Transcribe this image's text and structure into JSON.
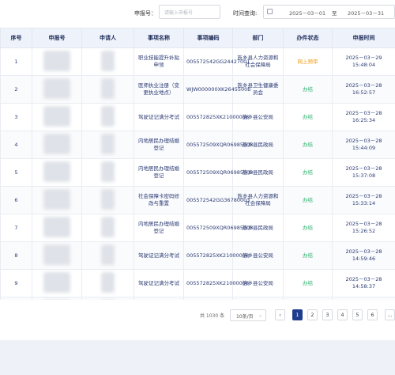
{
  "filters": {
    "application_no_label": "申报号：",
    "application_no_placeholder": "请输入申报号",
    "time_query_label": "时间查询:",
    "date_start": "2025－03－01",
    "date_to": "至",
    "date_end": "2025－03－31"
  },
  "table": {
    "columns": [
      "序号",
      "申报号",
      "申请人",
      "事项名称",
      "事项编码",
      "部门",
      "办件状态",
      "申报时间"
    ],
    "rows": [
      {
        "no": "1",
        "item": "职业技能提升补贴申领",
        "code": "005572542GG24427001",
        "dept": "旌乡县人力资源和社会保障局",
        "status": "网上预审",
        "status_type": "back",
        "time": "2025－03－29 15:48:04"
      },
      {
        "no": "2",
        "item": "医师执业注册（变更执业地点）",
        "code": "WJW000000XK2645500b",
        "dept": "旌乡县卫生健康委员会",
        "status": "办结",
        "status_type": "ok",
        "time": "2025－03－28 16:52:57"
      },
      {
        "no": "3",
        "item": "驾驶证记满分考试",
        "code": "005572825XK21000008",
        "dept": "旌乡县公安局",
        "status": "办结",
        "status_type": "ok",
        "time": "2025－03－28 16:25:34"
      },
      {
        "no": "4",
        "item": "内地居民办理结婚登记",
        "code": "005572509XQR06985003",
        "dept": "旌乡县民政局",
        "status": "办结",
        "status_type": "ok",
        "time": "2025－03－28 15:44:09"
      },
      {
        "no": "5",
        "item": "内地居民办理结婚登记",
        "code": "005572509XQR06985003",
        "dept": "旌乡县民政局",
        "status": "办结",
        "status_type": "ok",
        "time": "2025－03－28 15:37:08"
      },
      {
        "no": "6",
        "item": "社会保障卡密码修改与重置",
        "code": "005572542GG36780003",
        "dept": "旌乡县人力资源和社会保障局",
        "status": "办结",
        "status_type": "ok",
        "time": "2025－03－28 15:33:14"
      },
      {
        "no": "7",
        "item": "内地居民办理结婚登记",
        "code": "005572509XQR06985003",
        "dept": "旌乡县民政局",
        "status": "办结",
        "status_type": "ok",
        "time": "2025－03－28 15:26:52"
      },
      {
        "no": "8",
        "item": "驾驶证记满分考试",
        "code": "005572825XK21000008",
        "dept": "旌乡县公安局",
        "status": "办结",
        "status_type": "ok",
        "time": "2025－03－28 14:59:46"
      },
      {
        "no": "9",
        "item": "驾驶证记满分考试",
        "code": "005572825XK21000008",
        "dept": "旌乡县公安局",
        "status": "办结",
        "status_type": "ok",
        "time": "2025－03－28 14:58:37"
      },
      {
        "no": "10",
        "item": "驾驶证记满分考试",
        "code": "005572825XK21000008",
        "dept": "旌乡县公安局",
        "status": "办结",
        "status_type": "ok",
        "time": "2025－03－28 14:55:23"
      }
    ]
  },
  "pagination": {
    "total": "共 1030 条",
    "page_size": "10条/页",
    "prev": "‹",
    "pages": [
      "1",
      "2",
      "3",
      "4",
      "5",
      "6"
    ],
    "current": "1",
    "more": "…"
  },
  "colors": {
    "accent": "#1f3d8f",
    "header_bg": "#eef2fb",
    "status_ok": "#2db06e",
    "status_back": "#f0a020"
  }
}
